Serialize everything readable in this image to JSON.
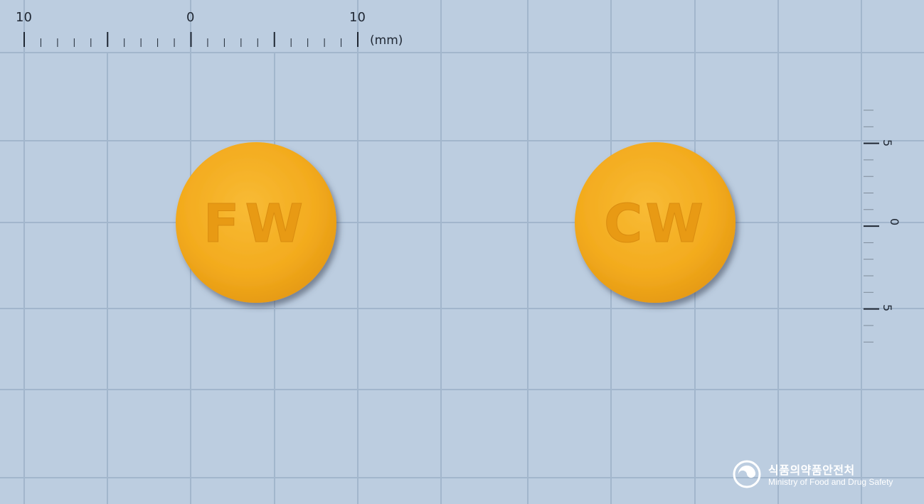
{
  "scale": {
    "horizontal_labels": [
      "10",
      "0",
      "10"
    ],
    "unit": "(mm)",
    "vertical_labels": [
      "5",
      "0",
      "5"
    ]
  },
  "tablets": [
    {
      "imprint": "FW",
      "color": "#f5b021"
    },
    {
      "imprint": "CW",
      "color": "#f5b021"
    }
  ],
  "logo": {
    "korean": "식품의약품안전처",
    "english": "Ministry of Food and Drug Safety"
  },
  "colors": {
    "background": "#bccde0",
    "grid": "#9fb3c9",
    "tablet": "#f5b021"
  }
}
